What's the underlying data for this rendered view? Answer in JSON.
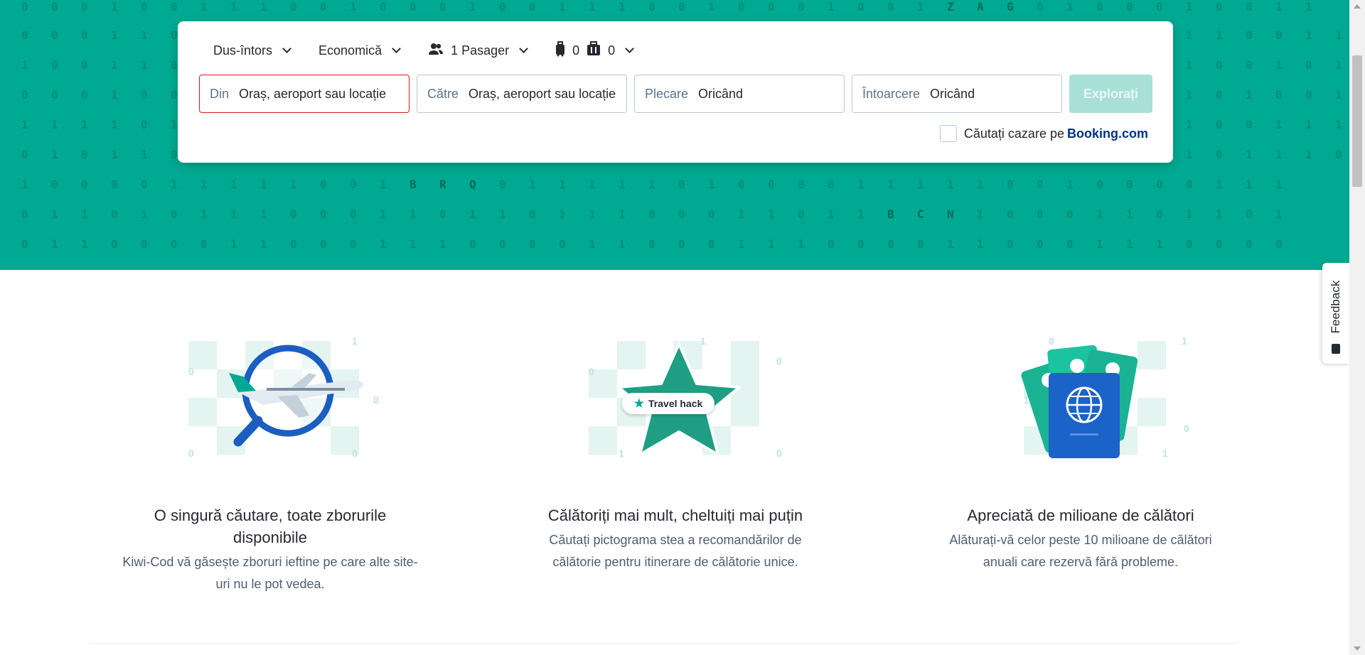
{
  "binary_rows": [
    "0 0 0 1 0 0 1 1 1 0 0 1 0 0 0 1 0 0 1 1 1 0 0 1 0 0 0 1 0 0 1 Z A G 0 1 0 0 0 1 0 0 1 1",
    "0 0 0 1 1 0 0 1 1 1 0 0 1 0 0 1 1 0 0 0 1 1 0 1 0 0 1 1 0 0 0 1 0 0 0 1 0 0 0 1 1 0 0 1 1",
    "1 0 0 1 1 0 1 0 1 0 0 1 1 0 0 1 0 1 0 1 1 0 0 1 1 0 0 0 1 0 1 1 0 0 1 1 0 0 1 1 0 0 1 0 1",
    "0 0 0 1 0 0 1 0 0 1 0 0 1 1 0 0 1 0 1 1 0 0 1 1 0 0 0 1 0 0 1 0 0 1 0 0 1 0 0 1 0 1 0 0 1",
    "1 1 1 1 0 1 0 0 0 1 1 0 0 1 0 1 1 0 0 1 0 0 1 1 0 1 0 0 1 1 0 1 0 0 1 0 0 1 1 1 0 0 1 1 1",
    "0 1 0 1 1 0 0 1 0 1 0 0 1 0 1 1 0 0 1 0 1 0 0 1 1 0 0 1 0 0 1 1 0 1 0 0 1 1 1 1 0 1 1 1 0",
    "1 0 0 0 0 1 1 1 1 1 0 0 1 B R Q 0 1 1 1 1 1 0 1 0 0 0 0 1 1 1 1 1 0 0 1 0 0 0 0 1 1 1",
    "0 1 1 0 1 0 1 1 1 0 0 0 1 1 0 1 1 0 1 1 1 0 0 0 1 1 0 1 1 B C N 1 0 0 0 1 1 0 1 1 0 1",
    "0 1 1 0 0 0 0 1 1 0 0 0 1 1 1 0 0 0 0 1 1 0 0 0 1 1 1 0 0 0 0 1 1 0 0 0 1 1 1 0 0 0 0"
  ],
  "search": {
    "trip_type": "Dus-întors",
    "cabin_class": "Economică",
    "passengers": "1 Pasager",
    "cabin_bags": "0",
    "checked_bags": "0",
    "from_label": "Din",
    "from_placeholder": "Oraș, aeroport sau locație",
    "to_label": "Către",
    "to_placeholder": "Oraș, aeroport sau locație",
    "depart_label": "Plecare",
    "depart_value": "Oricând",
    "return_label": "Întoarcere",
    "return_value": "Oricând",
    "explore_button": "Explorați",
    "booking_text": "Căutați cazare pe",
    "booking_brand": "Booking.com"
  },
  "features": [
    {
      "title": "O singură căutare, toate zborurile disponibile",
      "text": "Kiwi-Cod vă găsește zboruri ieftine pe care alte site-uri nu le pot vedea."
    },
    {
      "title": "Călătoriți mai mult, cheltuiți mai puțin",
      "text": "Căutați pictograma stea a recomandărilor de călătorie pentru itinerare de călătorie unice.",
      "badge": "Travel hack"
    },
    {
      "title": "Apreciată de milioane de călători",
      "text": "Alăturați-vă celor peste 10 milioane de călători anuali care rezervă fără probleme."
    }
  ],
  "feedback_label": "Feedback",
  "colors": {
    "brand_teal": "#00a991",
    "error_red": "#d21c1c",
    "booking_blue": "#003580",
    "disabled_button": "#a8e0d7"
  }
}
